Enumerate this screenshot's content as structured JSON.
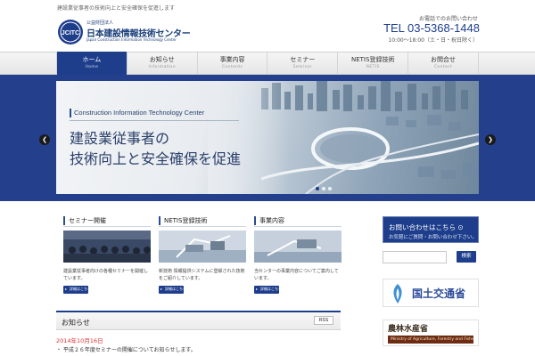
{
  "header": {
    "tagline": "建設業従事者の技術向上と安全確保を促進します",
    "logo": {
      "mark": "JCITC",
      "small": "公益財団法人",
      "name": "日本建設情報技術センター",
      "en": "Japan Construction Information Technology Center"
    },
    "contact_label": "お電話でのお問い合わせ",
    "tel": "TEL 03-5368-1448",
    "hours": "10:00～18:00（土・日・祝日除く）"
  },
  "nav": {
    "items": [
      {
        "jp": "ホーム",
        "en": "Home",
        "active": true
      },
      {
        "jp": "お知らせ",
        "en": "Information",
        "active": false
      },
      {
        "jp": "事業内容",
        "en": "Contents",
        "active": false
      },
      {
        "jp": "セミナー",
        "en": "Seminar",
        "active": false
      },
      {
        "jp": "NETIS登録技術",
        "en": "NETIS",
        "active": false
      },
      {
        "jp": "お問合せ",
        "en": "Contact",
        "active": false
      }
    ]
  },
  "hero": {
    "en": "Construction Information Technology Center",
    "line1": "建設業従事者の",
    "line2": "技術向上と安全確保を促進",
    "slide_count": 3,
    "active_slide": 1
  },
  "cards": [
    {
      "title": "セミナー開催",
      "text": "建設業従事者向けの各種セミナーを開催しています。",
      "button": "詳細はこちら"
    },
    {
      "title": "NETIS登録技術",
      "text": "新技術 情報提供システムに登録された技術をご紹介しています。",
      "button": "詳細はこちら"
    },
    {
      "title": "事業内容",
      "text": "当センターの事業内容についてご案内しています。",
      "button": "詳細はこちら"
    }
  ],
  "news": {
    "title": "お知らせ",
    "rss": "RSS",
    "date": "2014年10月16日",
    "item": "・ 平成２６年度セミナーの開催についてお知らせします。"
  },
  "sidebar": {
    "inquiry_line1": "お問い合わせはこちら ⊙",
    "inquiry_line2": "お気軽にご質問・お問い合わせ下さい。",
    "search_placeholder": "",
    "search_button": "検索",
    "mlit_text": "国土交通省",
    "maff_text": "農林水産省",
    "maff_en": "Ministry of Agriculture, Forestry and Fisheries"
  },
  "colors": {
    "primary": "#1e3e8c",
    "hero_band": "#24408c",
    "news_date": "#dd3333"
  }
}
